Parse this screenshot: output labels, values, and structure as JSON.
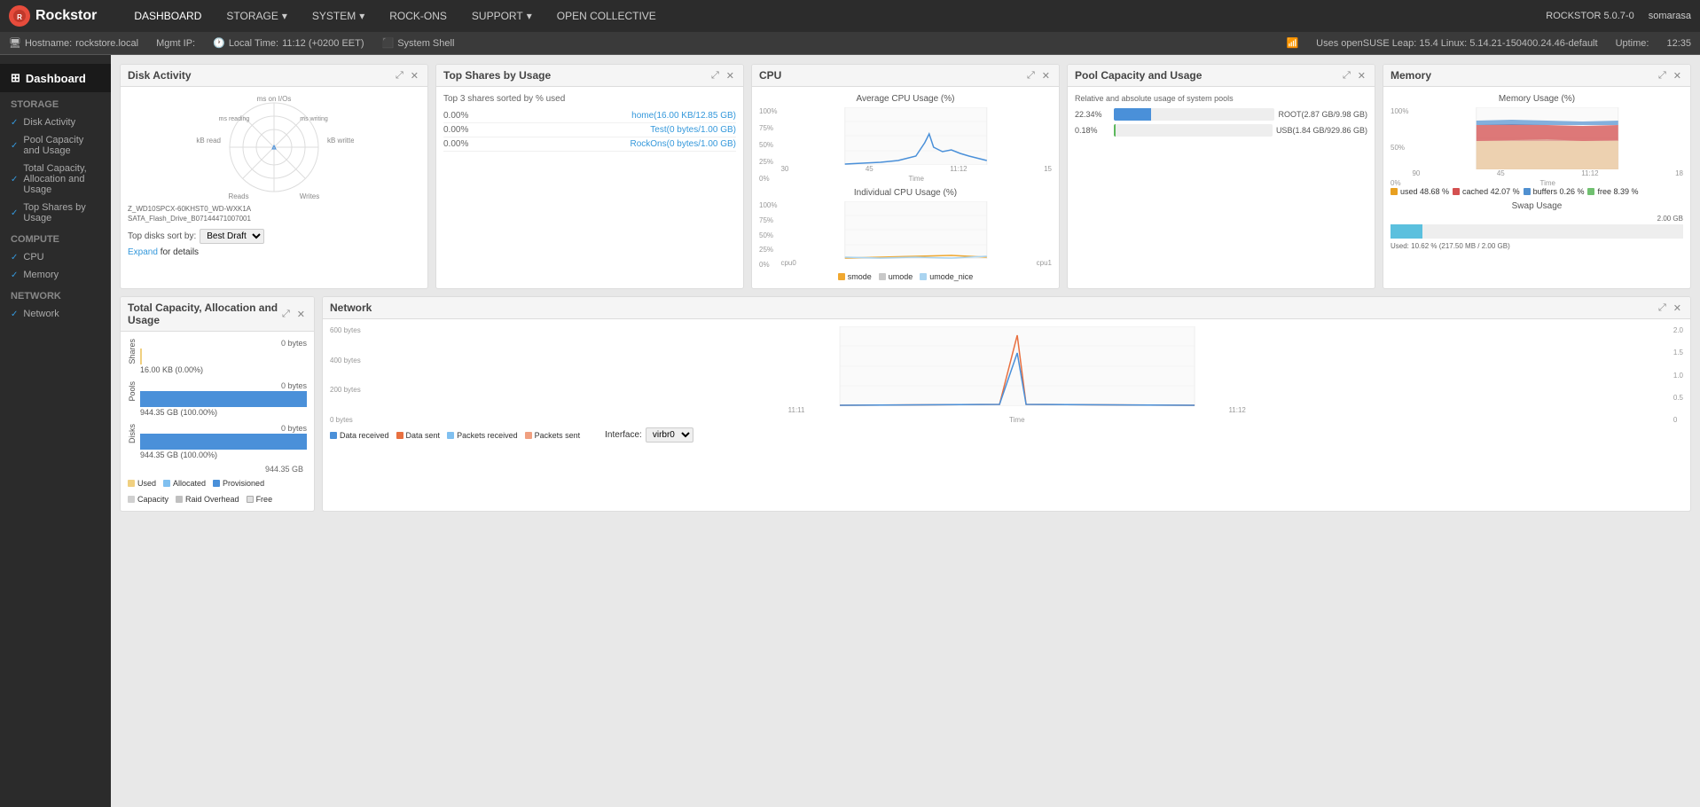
{
  "brand": {
    "name": "Rockstor",
    "version": "ROCKSTOR 5.0.7-0",
    "user": "somarasa"
  },
  "nav": {
    "items": [
      {
        "label": "DASHBOARD",
        "active": true
      },
      {
        "label": "STORAGE",
        "dropdown": true
      },
      {
        "label": "SYSTEM",
        "dropdown": true
      },
      {
        "label": "ROCK-ONS"
      },
      {
        "label": "SUPPORT",
        "dropdown": true
      },
      {
        "label": "OPEN COLLECTIVE"
      }
    ]
  },
  "statusbar": {
    "hostname_label": "Hostname:",
    "hostname": "rockstore.local",
    "mgmt_label": "Mgmt IP:",
    "time_label": "Local Time:",
    "time": "11:12 (+0200 EET)",
    "shell_label": "System Shell",
    "os_info": "Uses openSUSE Leap: 15.4 Linux: 5.14.21-150400.24.46-default",
    "uptime_label": "Uptime:",
    "uptime": "12:35"
  },
  "sidebar": {
    "title": "Dashboard",
    "storage_label": "Storage",
    "compute_label": "Compute",
    "network_label": "Network",
    "storage_items": [
      {
        "label": "Disk Activity",
        "checked": true
      },
      {
        "label": "Pool Capacity and Usage",
        "checked": true
      },
      {
        "label": "Total Capacity, Allocation and Usage",
        "checked": true
      },
      {
        "label": "Top Shares by Usage",
        "checked": true
      }
    ],
    "compute_items": [
      {
        "label": "CPU",
        "checked": true
      },
      {
        "label": "Memory",
        "checked": true
      }
    ],
    "network_items": [
      {
        "label": "Network",
        "checked": true
      }
    ]
  },
  "widgets": {
    "disk_activity": {
      "title": "Disk Activity",
      "labels": {
        "top": "ms on I/Os",
        "left": "kB read",
        "right": "kB written",
        "bottom_left": "Reads",
        "bottom_right": "Writes",
        "ms_reading": "ms reading",
        "ms_writing": "ms writing"
      },
      "disks": [
        "Z_WD10SPCX-60KHST0_WD-WXK1A",
        "SATA_Flash_Drive_B07144471007001"
      ],
      "top_disks_label": "Top disks sort by:",
      "sort_options": [
        "Best Draft"
      ],
      "sort_selected": "Best Draft",
      "expand_label": "Expand",
      "expand_suffix": "for details"
    },
    "top_shares": {
      "title": "Top Shares by Usage",
      "subtitle": "Top 3 shares sorted by % used",
      "shares": [
        {
          "percent": "0.00%",
          "name": "home(16.00 KB/12.85 GB)"
        },
        {
          "percent": "0.00%",
          "name": "Test(0 bytes/1.00 GB)"
        },
        {
          "percent": "0.00%",
          "name": "RockOns(0 bytes/1.00 GB)"
        }
      ]
    },
    "cpu": {
      "title": "CPU",
      "avg_title": "Average CPU Usage (%)",
      "ind_title": "Individual CPU Usage (%)",
      "y_labels_avg": [
        "100%",
        "75%",
        "50%",
        "25%",
        "0%"
      ],
      "y_labels_ind": [
        "100%",
        "75%",
        "50%",
        "25%",
        "0%"
      ],
      "x_label_avg": [
        "30",
        "45",
        "11:12",
        "15"
      ],
      "x_label_ind": [
        "cpu0",
        "cpu1"
      ],
      "time_label": "Time",
      "legend": [
        {
          "label": "smode",
          "color": "#f0a830"
        },
        {
          "label": "umode",
          "color": "#c8c8c8"
        },
        {
          "label": "umode_nice",
          "color": "#aad4f0"
        }
      ]
    },
    "pool_capacity": {
      "title": "Pool Capacity and Usage",
      "subtitle": "Relative and absolute usage of system pools",
      "pools": [
        {
          "percent": "22.34%",
          "bar_color": "#4a90d9",
          "label": "ROOT(2.87 GB/9.98 GB)"
        },
        {
          "percent": "0.18%",
          "bar_color": "#5cb85c",
          "label": "USB(1.84 GB/929.86 GB)"
        }
      ]
    },
    "memory": {
      "title": "Memory",
      "chart_title": "Memory Usage (%)",
      "y_labels": [
        "100%",
        "50%",
        "0%"
      ],
      "x_labels": [
        "90",
        "45",
        "11:12",
        "18"
      ],
      "time_label": "Time",
      "legend": [
        {
          "label": "used 48.68 %",
          "color": "#e8a020"
        },
        {
          "label": "cached 42.07 %",
          "color": "#d45050"
        },
        {
          "label": "buffers 0.26 %",
          "color": "#5090d0"
        },
        {
          "label": "free 8.39 %",
          "color": "#70c070"
        }
      ],
      "swap_title": "Swap Usage",
      "swap_right_label": "2.00 GB",
      "swap_used_label": "Used: 10.62 % (217.50 MB / 2.00 GB)"
    },
    "network": {
      "title": "Network",
      "y_labels_left": [
        "600 bytes",
        "400 bytes",
        "200 bytes",
        "0 bytes"
      ],
      "y_labels_right": [
        "2.0",
        "1.5",
        "1.0",
        "0.5",
        "0"
      ],
      "x_labels": [
        "11:11",
        "11:12"
      ],
      "time_label": "Time",
      "legend": [
        {
          "label": "Data received",
          "color": "#4a90d9"
        },
        {
          "label": "Data sent",
          "color": "#e87040"
        },
        {
          "label": "Packets received",
          "color": "#80c0f0"
        },
        {
          "label": "Packets sent",
          "color": "#f0a080"
        }
      ],
      "interface_label": "Interface:",
      "interface_options": [
        "virbr0"
      ],
      "interface_selected": "virbr0"
    },
    "total_capacity": {
      "title": "Total Capacity, Allocation and Usage",
      "shares_label": "Shares",
      "pools_label": "Pools",
      "disks_label": "Disks",
      "shares_top_label": "0 bytes",
      "pools_top_label": "0 bytes",
      "disks_top_label": "0 bytes",
      "shares_value": "16.00 KB (0.00%)",
      "pools_value": "944.35 GB (100.00%)",
      "disks_value": "944.35 GB (100.00%)",
      "axis_max": "944.35 GB",
      "legend": [
        {
          "label": "Used",
          "color": "#f0d080"
        },
        {
          "label": "Allocated",
          "color": "#80c0f0"
        },
        {
          "label": "Provisioned",
          "color": "#4a90d9"
        },
        {
          "label": "Capacity",
          "color": "#d0d0d0"
        },
        {
          "label": "Raid Overhead",
          "color": "#c0c0c0"
        },
        {
          "label": "Free",
          "color": "#e0e0e0"
        }
      ]
    }
  }
}
